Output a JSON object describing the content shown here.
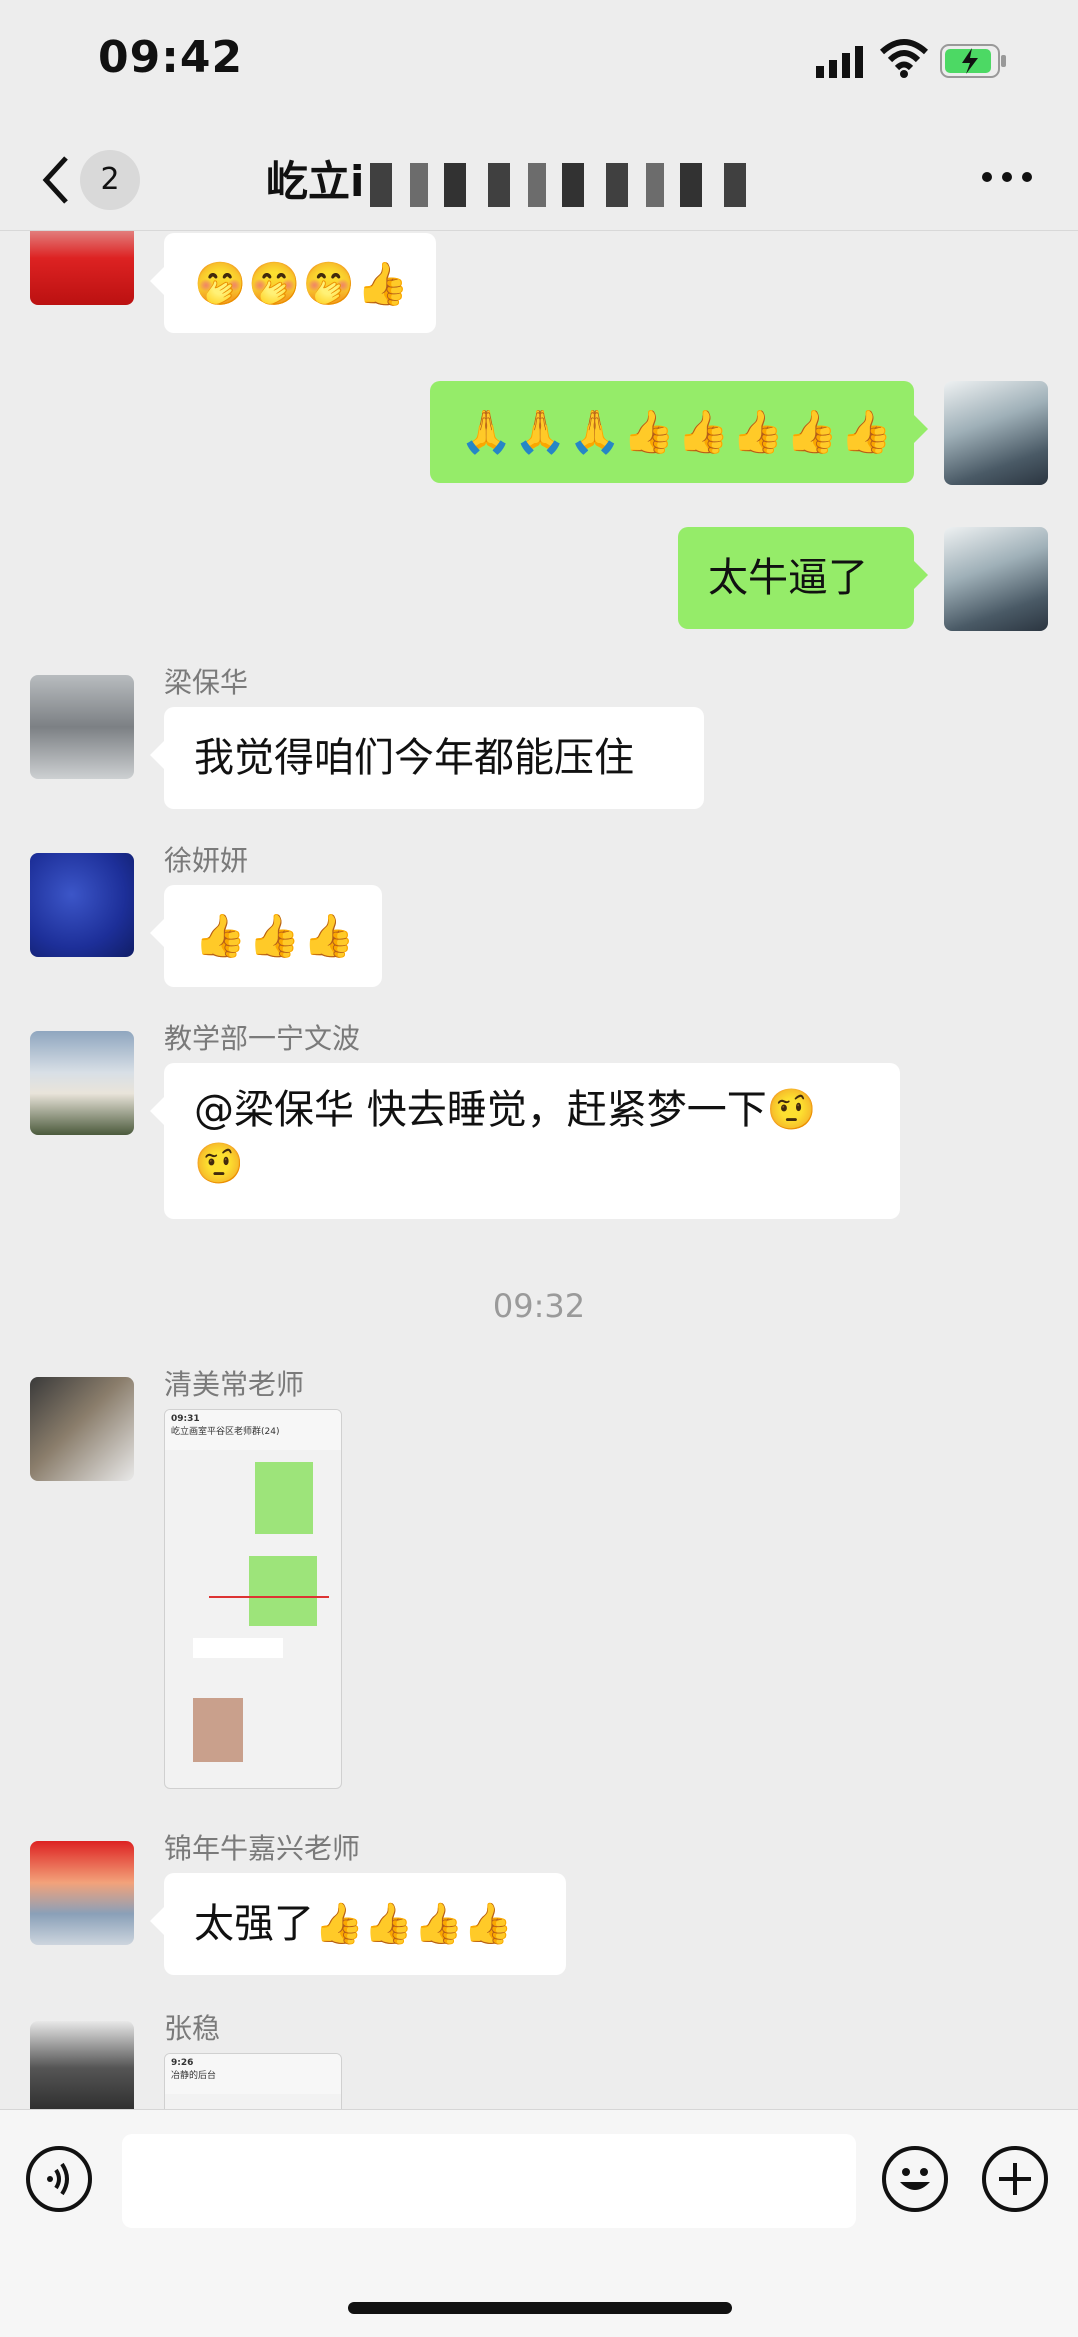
{
  "status_bar": {
    "time": "09:42"
  },
  "header": {
    "back_count": "2",
    "title": "屹立i",
    "more_label": "···"
  },
  "messages": {
    "m1": {
      "content": "🤭🤭🤭👍"
    },
    "m2": {
      "content": "🙏🙏🙏👍👍👍👍👍"
    },
    "m3": {
      "content": "太牛逼了"
    },
    "m4": {
      "sender": "梁保华",
      "content": "我觉得咱们今年都能压住"
    },
    "m5": {
      "sender": "徐妍妍",
      "content": "👍👍👍"
    },
    "m6": {
      "sender": "教学部一宁文波",
      "line1": "@梁保华 快去睡觉，赶紧梦一下🤨",
      "line2": "🤨"
    },
    "time_divider": "09:32",
    "m7": {
      "sender": "清美常老师",
      "thumb_time": "09:31",
      "thumb_title": "屹立画室平谷区老师群(24)"
    },
    "m8": {
      "sender": "锦年牛嘉兴老师",
      "content": "太强了👍👍👍👍"
    },
    "m9": {
      "sender": "张稳",
      "thumb_time": "9:26",
      "thumb_title": "冶静的后台"
    }
  },
  "input_bar": {
    "placeholder": ""
  },
  "colors": {
    "my_bubble": "#95ec69",
    "other_bubble": "#ffffff",
    "background": "#ededed"
  }
}
